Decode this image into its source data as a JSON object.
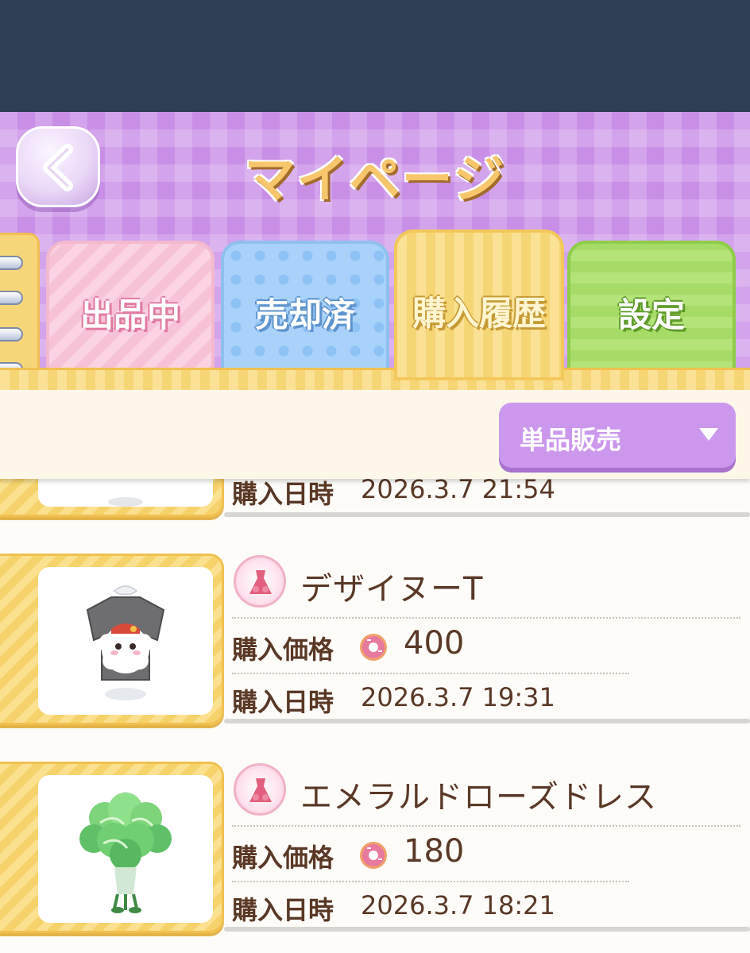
{
  "header": {
    "title": "マイページ",
    "back_icon": "chevron-left-icon"
  },
  "tabs": [
    {
      "label": "出品中",
      "active": false,
      "color": "#f8c2d6"
    },
    {
      "label": "売却済",
      "active": false,
      "color": "#a8d2fa"
    },
    {
      "label": "購入履歴",
      "active": true,
      "color": "#fbe196"
    },
    {
      "label": "設定",
      "active": false,
      "color": "#b4e379"
    }
  ],
  "filter": {
    "selected": "単品販売",
    "arrow_icon": "triangle-down-icon"
  },
  "labels": {
    "price": "購入価格",
    "date": "購入日時"
  },
  "purchases": [
    {
      "name": "",
      "price": "",
      "date": "2026.3.7  21:54",
      "thumb": "partial-item"
    },
    {
      "name": "デザイヌーT",
      "price": "400",
      "date": "2026.3.7  19:31",
      "thumb": "sheep-tshirt"
    },
    {
      "name": "エメラルドローズドレス",
      "price": "180",
      "date": "2026.3.7  18:21",
      "thumb": "green-rose-dress"
    }
  ],
  "colors": {
    "topbar": "#2e3f54",
    "header_bg": "#c98fe6",
    "dropdown": "#cc98ee",
    "text": "#5a3826",
    "donut": "#e8799e"
  }
}
